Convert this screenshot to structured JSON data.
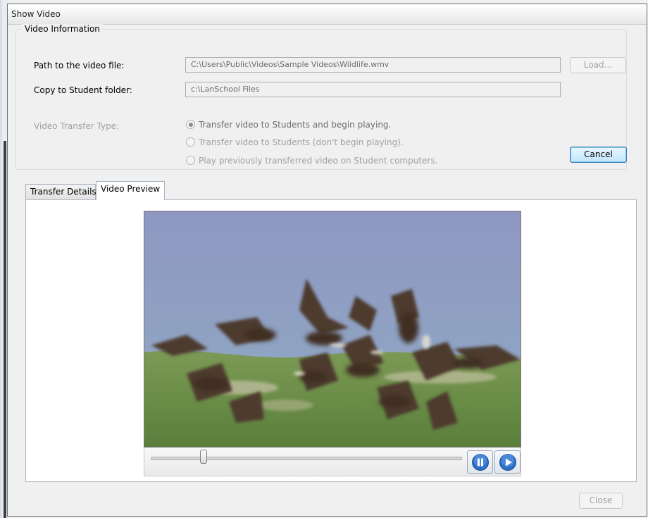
{
  "window": {
    "title": "Show Video"
  },
  "video_info": {
    "group_label": "Video Information",
    "path_label": "Path to the video file:",
    "path_value": "C:\\Users\\Public\\Videos\\Sample Videos\\Wildlife.wmv",
    "copy_label": "Copy to Student folder:",
    "copy_value": "c:\\LanSchool Files",
    "load_button": "Load...",
    "transfer_type_label": "Video Transfer Type:",
    "transfer_options": [
      {
        "label": "Transfer video to Students and begin playing.",
        "selected": true
      },
      {
        "label": "Transfer video to Students (don't begin playing).",
        "selected": false
      },
      {
        "label": "Play previously transferred video on Student computers.",
        "selected": false
      }
    ],
    "cancel_button": "Cancel"
  },
  "tabs": [
    {
      "label": "Transfer Details",
      "active": false
    },
    {
      "label": "Video Preview",
      "active": true
    }
  ],
  "player": {
    "seek_position": 0.17,
    "pause_icon": "pause-icon",
    "play_icon": "play-icon"
  },
  "footer": {
    "close_button": "Close"
  },
  "colors": {
    "accent": "#3c7fb1",
    "disabled_text": "#a0a0a0"
  }
}
